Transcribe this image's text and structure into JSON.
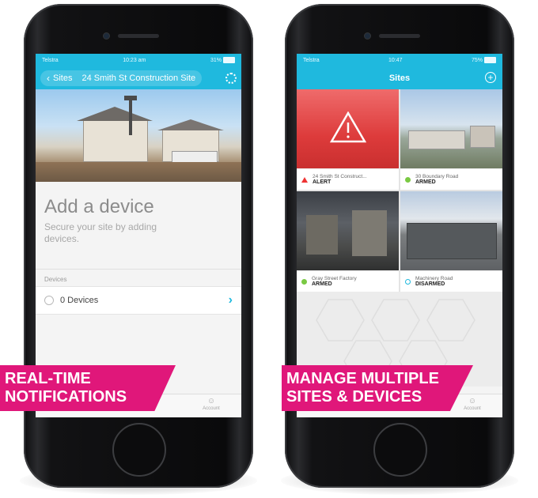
{
  "phone_left": {
    "status_bar": {
      "carrier": "Telstra",
      "time": "10:23 am",
      "battery": "31%"
    },
    "nav": {
      "back_label": "Sites",
      "title": "24 Smith St Construction Site"
    },
    "add_device": {
      "title": "Add a device",
      "subtitle": "Secure your site by adding devices."
    },
    "devices_section_label": "Devices",
    "devices_row": "0 Devices",
    "tab": {
      "label": "Account"
    }
  },
  "phone_right": {
    "status_bar": {
      "carrier": "Telstra",
      "time": "10:47",
      "battery": "75%"
    },
    "nav": {
      "title": "Sites"
    },
    "sites": [
      {
        "name": "24 Smith St Construct...",
        "status": "ALERT",
        "indicator": "alert-triangle",
        "color": "#e53935"
      },
      {
        "name": "30 Boundary Road",
        "status": "ARMED",
        "indicator": "filled-dot",
        "color": "#7ac943"
      },
      {
        "name": "Gray Street Factory",
        "status": "ARMED",
        "indicator": "filled-dot",
        "color": "#7ac943"
      },
      {
        "name": "Machinery Road",
        "status": "DISARMED",
        "indicator": "hollow-dot",
        "color": "#1fb9de"
      }
    ],
    "tab": {
      "label": "Account"
    }
  },
  "banners": {
    "left": [
      "REAL-TIME",
      "NOTIFICATIONS"
    ],
    "right": [
      "MANAGE MULTIPLE",
      "SITES & DEVICES"
    ]
  },
  "colors": {
    "accent": "#1fb9de",
    "banner": "#e0177a",
    "alert": "#e53935",
    "armed": "#7ac943"
  }
}
